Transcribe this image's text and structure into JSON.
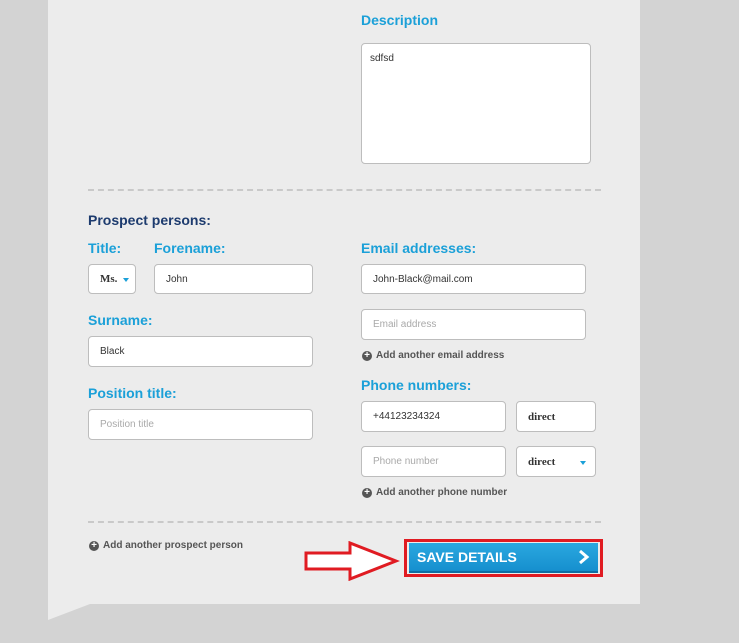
{
  "description": {
    "label": "Description",
    "value": "sdfsd"
  },
  "prospect": {
    "section_title": "Prospect persons:",
    "title_label": "Title:",
    "title_value": "Ms.",
    "forename_label": "Forename:",
    "forename_value": "John",
    "surname_label": "Surname:",
    "surname_value": "Black",
    "position_label": "Position title:",
    "position_placeholder": "Position title",
    "email_label": "Email addresses:",
    "email_value": "John-Black@mail.com",
    "email_placeholder": "Email address",
    "add_email": "Add another email address",
    "phone_label": "Phone numbers:",
    "phone_value": "+44123234324",
    "phone_type_1": "direct",
    "phone_placeholder": "Phone number",
    "phone_type_2": "direct",
    "add_phone": "Add another phone number",
    "add_person": "Add another prospect person"
  },
  "save_button": "SAVE DETAILS",
  "colors": {
    "accent": "#1ba0d8",
    "heading": "#1d3b6e",
    "highlight": "#e01b22"
  }
}
